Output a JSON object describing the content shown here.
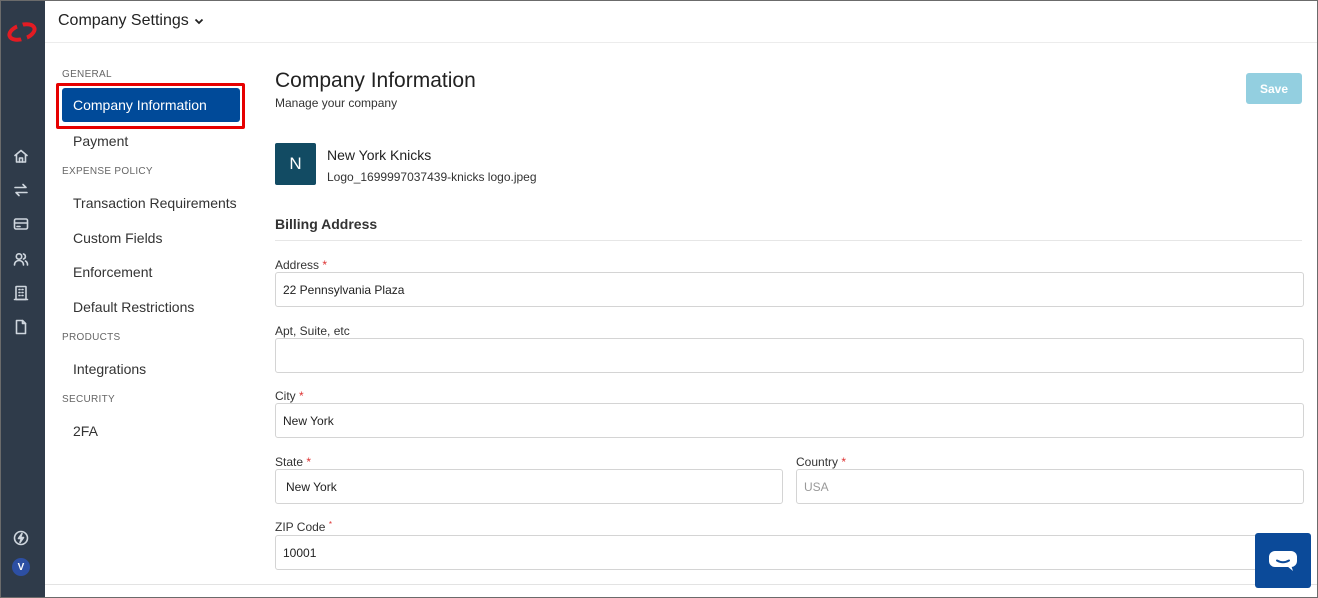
{
  "header": {
    "title": "Company Settings"
  },
  "nav": {
    "sections": [
      {
        "label": "GENERAL"
      },
      {
        "label": "EXPENSE POLICY"
      },
      {
        "label": "PRODUCTS"
      },
      {
        "label": "SECURITY"
      }
    ],
    "items": [
      {
        "label": "Company Information"
      },
      {
        "label": "Payment"
      },
      {
        "label": "Transaction Requirements"
      },
      {
        "label": "Custom Fields"
      },
      {
        "label": "Enforcement"
      },
      {
        "label": "Default Restrictions"
      },
      {
        "label": "Integrations"
      },
      {
        "label": "2FA"
      }
    ]
  },
  "main": {
    "title": "Company Information",
    "subtitle": "Manage your company",
    "save_label": "Save",
    "company": {
      "initial": "N",
      "name": "New York Knicks",
      "logo_file": "Logo_1699997037439-knicks logo.jpeg"
    },
    "billing_title": "Billing Address",
    "fields": {
      "address": {
        "label": "Address",
        "value": "22 Pennsylvania Plaza"
      },
      "apt": {
        "label": "Apt, Suite, etc",
        "value": ""
      },
      "city": {
        "label": "City",
        "value": "New York"
      },
      "state": {
        "label": "State",
        "value": "New York"
      },
      "country": {
        "label": "Country",
        "value": "USA"
      },
      "zip": {
        "label": "ZIP Code",
        "value": "10001"
      }
    },
    "required_mark": "*"
  },
  "user": {
    "avatar_initial": "V"
  },
  "colors": {
    "rail": "#2f3b4a",
    "active": "#004a99",
    "highlight": "#e60000",
    "save": "#93cfe0",
    "logo": "#124b63",
    "brand": "#e31b23"
  },
  "icons": [
    "brand-logo-icon",
    "home-icon",
    "transfer-icon",
    "card-icon",
    "users-icon",
    "building-icon",
    "document-icon",
    "bolt-icon",
    "chevron-down-icon",
    "chat-icon"
  ]
}
